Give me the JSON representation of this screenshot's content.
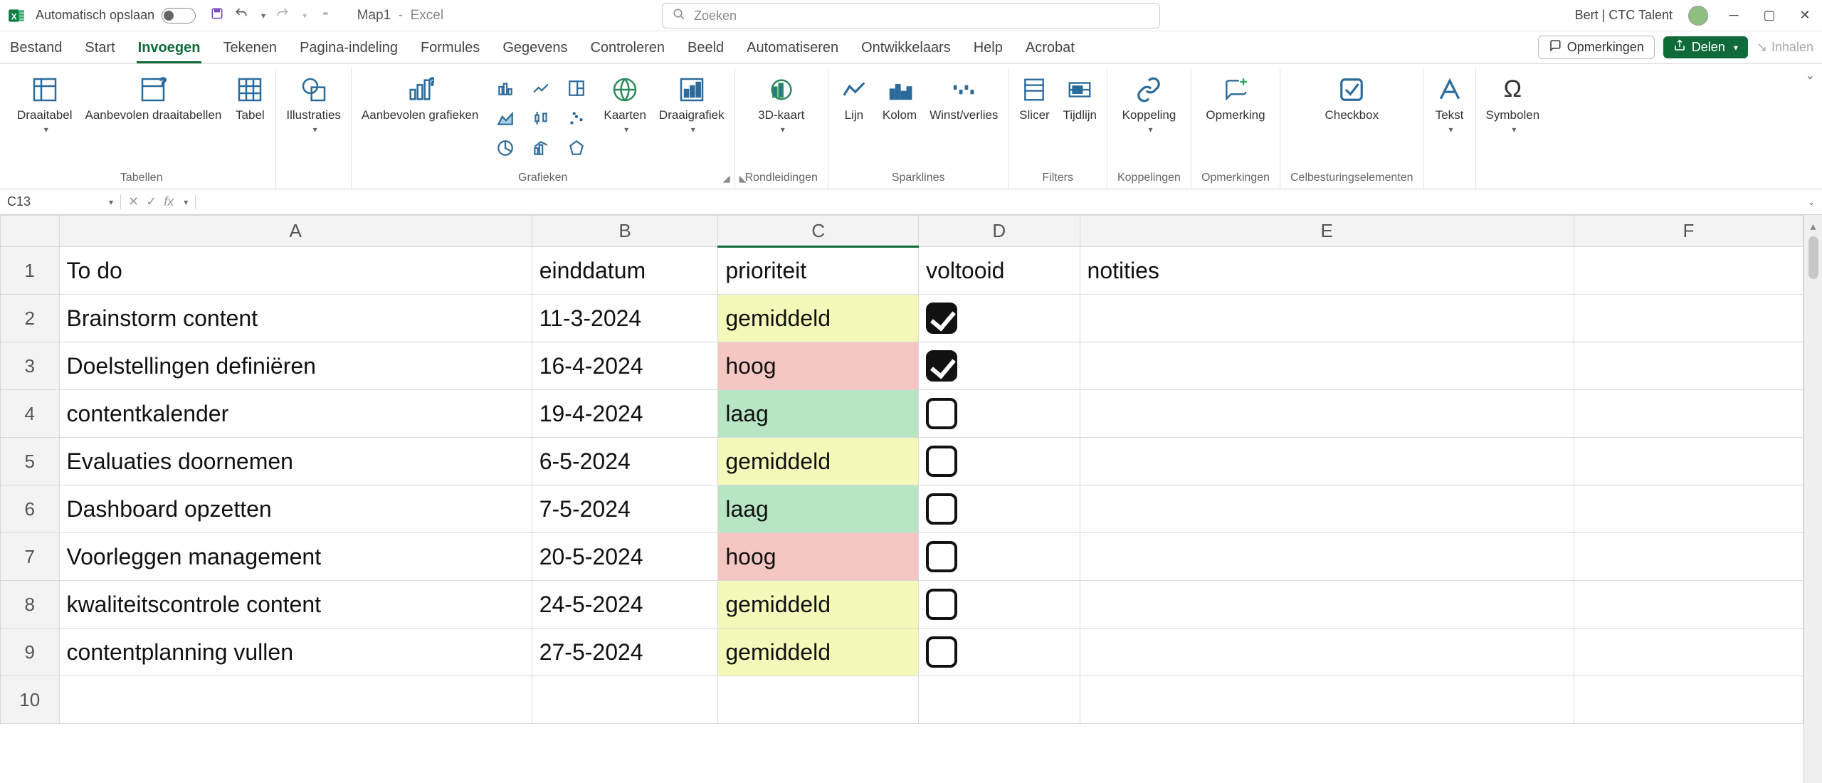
{
  "titlebar": {
    "autosave_label": "Automatisch opslaan",
    "doc_name": "Map1",
    "app_name": "Excel",
    "search_placeholder": "Zoeken",
    "user_name": "Bert | CTC Talent"
  },
  "tabs": {
    "items": [
      "Bestand",
      "Start",
      "Invoegen",
      "Tekenen",
      "Pagina-indeling",
      "Formules",
      "Gegevens",
      "Controleren",
      "Beeld",
      "Automatiseren",
      "Ontwikkelaars",
      "Help",
      "Acrobat"
    ],
    "active_index": 2,
    "comments_label": "Opmerkingen",
    "share_label": "Delen",
    "catchup_label": "Inhalen"
  },
  "ribbon": {
    "groups": [
      {
        "label": "Tabellen",
        "buttons": [
          "Draaitabel",
          "Aanbevolen draaitabellen",
          "Tabel"
        ]
      },
      {
        "label": "",
        "buttons": [
          "Illustraties"
        ]
      },
      {
        "label": "Grafieken",
        "buttons": [
          "Aanbevolen grafieken",
          "Kaarten",
          "Draaigrafiek"
        ]
      },
      {
        "label": "Rondleidingen",
        "buttons": [
          "3D-kaart"
        ]
      },
      {
        "label": "Sparklines",
        "buttons": [
          "Lijn",
          "Kolom",
          "Winst/verlies"
        ]
      },
      {
        "label": "Filters",
        "buttons": [
          "Slicer",
          "Tijdlijn"
        ]
      },
      {
        "label": "Koppelingen",
        "buttons": [
          "Koppeling"
        ]
      },
      {
        "label": "Opmerkingen",
        "buttons": [
          "Opmerking"
        ]
      },
      {
        "label": "Celbesturingselementen",
        "buttons": [
          "Checkbox"
        ]
      },
      {
        "label": "",
        "buttons": [
          "Tekst"
        ]
      },
      {
        "label": "",
        "buttons": [
          "Symbolen"
        ]
      }
    ]
  },
  "formula_bar": {
    "name_box": "C13",
    "formula": ""
  },
  "sheet": {
    "columns": [
      "A",
      "B",
      "C",
      "D",
      "E",
      "F"
    ],
    "selected_column_index": 2,
    "selected_cell": "C13",
    "headers": {
      "A": "To do",
      "B": "einddatum",
      "C": "prioriteit",
      "D": "voltooid",
      "E": "notities"
    },
    "rows": [
      {
        "n": 2,
        "A": "Brainstorm content",
        "B": "11-3-2024",
        "C": "gemiddeld",
        "Cclass": "mid",
        "D": true
      },
      {
        "n": 3,
        "A": "Doelstellingen definiëren",
        "B": "16-4-2024",
        "C": "hoog",
        "Cclass": "high",
        "D": true
      },
      {
        "n": 4,
        "A": "contentkalender",
        "B": "19-4-2024",
        "C": "laag",
        "Cclass": "low",
        "D": false
      },
      {
        "n": 5,
        "A": "Evaluaties doornemen",
        "B": "6-5-2024",
        "C": "gemiddeld",
        "Cclass": "mid",
        "D": false
      },
      {
        "n": 6,
        "A": "Dashboard opzetten",
        "B": "7-5-2024",
        "C": "laag",
        "Cclass": "low",
        "D": false
      },
      {
        "n": 7,
        "A": "Voorleggen management",
        "B": "20-5-2024",
        "C": "hoog",
        "Cclass": "high",
        "D": false
      },
      {
        "n": 8,
        "A": "kwaliteitscontrole content",
        "B": "24-5-2024",
        "C": "gemiddeld",
        "Cclass": "mid",
        "D": false
      },
      {
        "n": 9,
        "A": "contentplanning vullen",
        "B": "27-5-2024",
        "C": "gemiddeld",
        "Cclass": "mid",
        "D": false
      }
    ],
    "blank_rows": [
      10
    ]
  },
  "chart_data": {
    "type": "table",
    "columns": [
      "To do",
      "einddatum",
      "prioriteit",
      "voltooid"
    ],
    "rows": [
      [
        "Brainstorm content",
        "11-3-2024",
        "gemiddeld",
        true
      ],
      [
        "Doelstellingen definiëren",
        "16-4-2024",
        "hoog",
        true
      ],
      [
        "contentkalender",
        "19-4-2024",
        "laag",
        false
      ],
      [
        "Evaluaties doornemen",
        "6-5-2024",
        "gemiddeld",
        false
      ],
      [
        "Dashboard opzetten",
        "7-5-2024",
        "laag",
        false
      ],
      [
        "Voorleggen management",
        "20-5-2024",
        "hoog",
        false
      ],
      [
        "kwaliteitscontrole content",
        "24-5-2024",
        "gemiddeld",
        false
      ],
      [
        "contentplanning vullen",
        "27-5-2024",
        "gemiddeld",
        false
      ]
    ]
  }
}
